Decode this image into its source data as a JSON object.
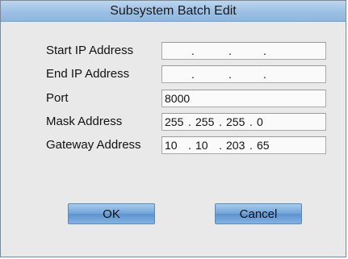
{
  "dialog": {
    "title": "Subsystem Batch Edit"
  },
  "fields": {
    "start_ip": {
      "label": "Start IP Address",
      "octets": [
        "",
        "",
        "",
        ""
      ]
    },
    "end_ip": {
      "label": "End IP Address",
      "octets": [
        "",
        "",
        "",
        ""
      ]
    },
    "port": {
      "label": "Port",
      "value": "8000"
    },
    "mask": {
      "label": "Mask Address",
      "octets": [
        "255",
        "255",
        "255",
        "0"
      ]
    },
    "gateway": {
      "label": "Gateway Address",
      "octets": [
        "10",
        "10",
        "203",
        "65"
      ]
    }
  },
  "buttons": {
    "ok_label": "OK",
    "cancel_label": "Cancel"
  },
  "colors": {
    "titlebar": "#9cc0e4",
    "button": "#6fa3d8",
    "background": "#e6e6e6"
  }
}
